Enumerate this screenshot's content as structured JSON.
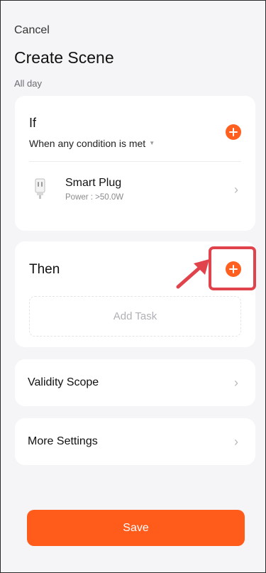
{
  "header": {
    "cancel_label": "Cancel",
    "title": "Create Scene",
    "subtitle": "All day"
  },
  "if_card": {
    "label": "If",
    "condition_mode": "When any condition is met",
    "add_icon": "plus-circle-icon",
    "device": {
      "name": "Smart Plug",
      "detail": "Power : >50.0W",
      "icon": "smart-plug-icon"
    }
  },
  "then_card": {
    "label": "Then",
    "add_icon": "plus-circle-icon",
    "add_task_label": "Add Task",
    "highlight_color": "#e0434b"
  },
  "settings": {
    "validity_label": "Validity Scope",
    "more_label": "More Settings"
  },
  "footer": {
    "save_label": "Save"
  },
  "colors": {
    "accent": "#ff5c1c",
    "background": "#f5f5f7",
    "card": "#ffffff"
  }
}
